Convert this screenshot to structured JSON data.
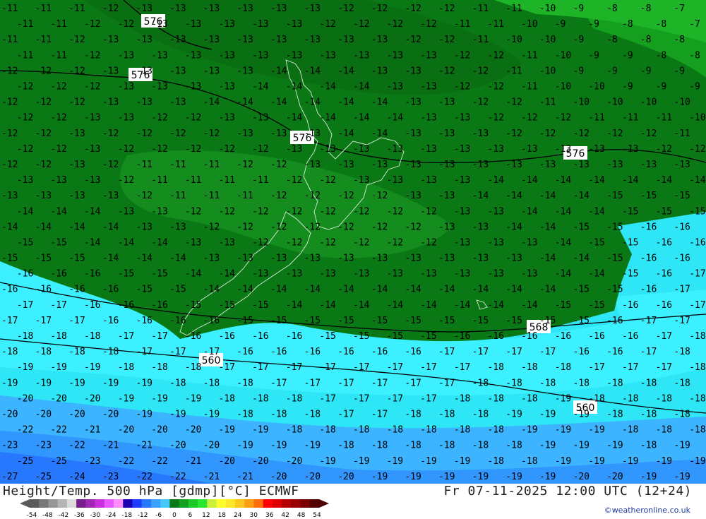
{
  "footer": {
    "title": "Height/Temp. 500 hPa [gdmp][°C] ECMWF",
    "datetime": "Fr 07-11-2025 12:00 UTC (12+24)",
    "credit": "©weatheronline.co.uk"
  },
  "legend": {
    "colors": [
      "#5a5a5a",
      "#787878",
      "#969696",
      "#b4b4b4",
      "#dcdcdc",
      "#781e8c",
      "#a028b4",
      "#c832dc",
      "#e65aff",
      "#ff8cff",
      "#1e00b4",
      "#1e3cff",
      "#2878ff",
      "#3ca0ff",
      "#46c8ff",
      "#0a7814",
      "#14a01e",
      "#1ec828",
      "#28e632",
      "#c8f03c",
      "#ffff28",
      "#ffe628",
      "#ffc81e",
      "#ffa014",
      "#ff6e0a",
      "#ff0000",
      "#dc0000",
      "#b40000",
      "#960000",
      "#780000",
      "#500000"
    ],
    "tick_labels": [
      "-54",
      "-48",
      "-42",
      "-36",
      "-30",
      "-24",
      "-18",
      "-12",
      "-6",
      "0",
      "6",
      "12",
      "18",
      "24",
      "30",
      "36",
      "42",
      "48",
      "54"
    ]
  },
  "height_labels": [
    "576",
    "576",
    "576",
    "576",
    "568",
    "560",
    "560"
  ],
  "temp_rows": [
    {
      "values": [
        "-11",
        "-11",
        "-11",
        "-12",
        "-13",
        "-13",
        "-13",
        "-13",
        "-13",
        "-13",
        "-12",
        "-12",
        "-12",
        "-12",
        "-11",
        "-11",
        "-10",
        "-9",
        "-8",
        "-8",
        "-7"
      ]
    },
    {
      "values": [
        "-11",
        "-11",
        "-12",
        "-12",
        "-13",
        "-13",
        "-13",
        "-13",
        "-13",
        "-12",
        "-12",
        "-12",
        "-12",
        "-11",
        "-11",
        "-10",
        "-9",
        "-9",
        "-8",
        "-8",
        "-7"
      ]
    },
    {
      "values": [
        "-11",
        "-11",
        "-12",
        "-13",
        "-13",
        "-13",
        "-13",
        "-13",
        "-13",
        "-13",
        "-13",
        "-13",
        "-12",
        "-12",
        "-11",
        "-10",
        "-10",
        "-9",
        "-8",
        "-8",
        "-8"
      ]
    },
    {
      "values": [
        "-11",
        "-11",
        "-12",
        "-13",
        "-13",
        "-13",
        "-13",
        "-13",
        "-13",
        "-13",
        "-13",
        "-13",
        "-13",
        "-12",
        "-12",
        "-11",
        "-10",
        "-9",
        "-9",
        "-8",
        "-8"
      ]
    },
    {
      "values": [
        "-12",
        "-12",
        "-12",
        "-13",
        "-13",
        "-13",
        "-13",
        "-13",
        "-14",
        "-14",
        "-14",
        "-13",
        "-13",
        "-12",
        "-12",
        "-11",
        "-10",
        "-9",
        "-9",
        "-9",
        "-9"
      ]
    },
    {
      "values": [
        "-12",
        "-12",
        "-12",
        "-13",
        "-13",
        "-13",
        "-13",
        "-14",
        "-14",
        "-14",
        "-14",
        "-13",
        "-13",
        "-12",
        "-12",
        "-11",
        "-10",
        "-10",
        "-9",
        "-9",
        "-9"
      ]
    },
    {
      "values": [
        "-12",
        "-12",
        "-12",
        "-13",
        "-13",
        "-13",
        "-14",
        "-14",
        "-14",
        "-14",
        "-14",
        "-14",
        "-13",
        "-13",
        "-12",
        "-12",
        "-11",
        "-10",
        "-10",
        "-10",
        "-10"
      ]
    },
    {
      "values": [
        "-12",
        "-12",
        "-13",
        "-13",
        "-12",
        "-12",
        "-13",
        "-13",
        "-14",
        "-14",
        "-14",
        "-14",
        "-13",
        "-13",
        "-12",
        "-12",
        "-12",
        "-11",
        "-11",
        "-11",
        "-10"
      ]
    },
    {
      "values": [
        "-12",
        "-12",
        "-13",
        "-12",
        "-12",
        "-12",
        "-12",
        "-13",
        "-13",
        "-13",
        "-14",
        "-14",
        "-13",
        "-13",
        "-13",
        "-12",
        "-12",
        "-12",
        "-12",
        "-12",
        "-11"
      ]
    },
    {
      "values": [
        "-12",
        "-12",
        "-13",
        "-12",
        "-12",
        "-12",
        "-12",
        "-12",
        "-13",
        "-13",
        "-13",
        "-13",
        "-13",
        "-13",
        "-13",
        "-13",
        "-13",
        "-13",
        "-13",
        "-12",
        "-12"
      ]
    },
    {
      "values": [
        "-12",
        "-12",
        "-13",
        "-12",
        "-11",
        "-11",
        "-11",
        "-12",
        "-12",
        "-13",
        "-13",
        "-13",
        "-13",
        "-13",
        "-13",
        "-13",
        "-13",
        "-13",
        "-13",
        "-13",
        "-13"
      ]
    },
    {
      "values": [
        "-13",
        "-13",
        "-13",
        "-12",
        "-11",
        "-11",
        "-11",
        "-11",
        "-12",
        "-12",
        "-13",
        "-13",
        "-13",
        "-13",
        "-14",
        "-14",
        "-14",
        "-14",
        "-14",
        "-14",
        "-14"
      ]
    },
    {
      "values": [
        "-13",
        "-13",
        "-13",
        "-13",
        "-12",
        "-11",
        "-11",
        "-11",
        "-12",
        "-12",
        "-12",
        "-12",
        "-13",
        "-13",
        "-14",
        "-14",
        "-14",
        "-14",
        "-15",
        "-15",
        "-15"
      ]
    },
    {
      "values": [
        "-14",
        "-14",
        "-14",
        "-13",
        "-13",
        "-12",
        "-12",
        "-12",
        "-12",
        "-12",
        "-12",
        "-12",
        "-12",
        "-13",
        "-13",
        "-14",
        "-14",
        "-14",
        "-15",
        "-15",
        "-15"
      ]
    },
    {
      "values": [
        "-14",
        "-14",
        "-14",
        "-14",
        "-13",
        "-13",
        "-12",
        "-12",
        "-12",
        "-12",
        "-12",
        "-12",
        "-12",
        "-13",
        "-13",
        "-14",
        "-14",
        "-15",
        "-15",
        "-16",
        "-16"
      ]
    },
    {
      "values": [
        "-15",
        "-15",
        "-14",
        "-14",
        "-14",
        "-13",
        "-13",
        "-12",
        "-12",
        "-12",
        "-12",
        "-12",
        "-12",
        "-13",
        "-13",
        "-13",
        "-14",
        "-15",
        "-15",
        "-16",
        "-16"
      ]
    },
    {
      "values": [
        "-15",
        "-15",
        "-15",
        "-14",
        "-14",
        "-14",
        "-13",
        "-13",
        "-13",
        "-13",
        "-13",
        "-13",
        "-13",
        "-13",
        "-13",
        "-13",
        "-14",
        "-14",
        "-15",
        "-16",
        "-16"
      ]
    },
    {
      "values": [
        "-16",
        "-16",
        "-16",
        "-15",
        "-15",
        "-14",
        "-14",
        "-13",
        "-13",
        "-13",
        "-13",
        "-13",
        "-13",
        "-13",
        "-13",
        "-13",
        "-14",
        "-14",
        "-15",
        "-16",
        "-17"
      ]
    },
    {
      "values": [
        "-16",
        "-16",
        "-16",
        "-16",
        "-15",
        "-15",
        "-14",
        "-14",
        "-14",
        "-14",
        "-14",
        "-14",
        "-14",
        "-14",
        "-14",
        "-14",
        "-14",
        "-15",
        "-15",
        "-16",
        "-17"
      ]
    },
    {
      "values": [
        "-17",
        "-17",
        "-16",
        "-16",
        "-16",
        "-15",
        "-15",
        "-15",
        "-14",
        "-14",
        "-14",
        "-14",
        "-14",
        "-14",
        "-14",
        "-14",
        "-15",
        "-15",
        "-16",
        "-16",
        "-17"
      ]
    },
    {
      "values": [
        "-17",
        "-17",
        "-17",
        "-16",
        "-16",
        "-16",
        "-16",
        "-15",
        "-15",
        "-15",
        "-15",
        "-15",
        "-15",
        "-15",
        "-15",
        "-15",
        "-15",
        "-15",
        "-16",
        "-17",
        "-17"
      ]
    },
    {
      "values": [
        "-18",
        "-18",
        "-18",
        "-17",
        "-17",
        "-16",
        "-16",
        "-16",
        "-16",
        "-15",
        "-15",
        "-15",
        "-15",
        "-16",
        "-16",
        "-16",
        "-16",
        "-16",
        "-16",
        "-17",
        "-18"
      ]
    },
    {
      "values": [
        "-18",
        "-18",
        "-18",
        "-18",
        "-17",
        "-17",
        "-17",
        "-16",
        "-16",
        "-16",
        "-16",
        "-16",
        "-16",
        "-17",
        "-17",
        "-17",
        "-17",
        "-16",
        "-16",
        "-17",
        "-18"
      ]
    },
    {
      "values": [
        "-19",
        "-19",
        "-19",
        "-18",
        "-18",
        "-18",
        "-17",
        "-17",
        "-17",
        "-17",
        "-17",
        "-17",
        "-17",
        "-17",
        "-18",
        "-18",
        "-18",
        "-17",
        "-17",
        "-17",
        "-18"
      ]
    },
    {
      "values": [
        "-19",
        "-19",
        "-19",
        "-19",
        "-19",
        "-18",
        "-18",
        "-18",
        "-17",
        "-17",
        "-17",
        "-17",
        "-17",
        "-17",
        "-18",
        "-18",
        "-18",
        "-18",
        "-18",
        "-18",
        "-18"
      ]
    },
    {
      "values": [
        "-20",
        "-20",
        "-20",
        "-19",
        "-19",
        "-19",
        "-18",
        "-18",
        "-18",
        "-17",
        "-17",
        "-17",
        "-17",
        "-18",
        "-18",
        "-18",
        "-19",
        "-18",
        "-18",
        "-18",
        "-18"
      ]
    },
    {
      "values": [
        "-20",
        "-20",
        "-20",
        "-20",
        "-19",
        "-19",
        "-19",
        "-18",
        "-18",
        "-18",
        "-17",
        "-17",
        "-18",
        "-18",
        "-18",
        "-19",
        "-19",
        "-19",
        "-18",
        "-18",
        "-18"
      ]
    },
    {
      "values": [
        "-22",
        "-22",
        "-21",
        "-20",
        "-20",
        "-20",
        "-19",
        "-19",
        "-18",
        "-18",
        "-18",
        "-18",
        "-18",
        "-18",
        "-18",
        "-19",
        "-19",
        "-19",
        "-18",
        "-18",
        "-18"
      ]
    },
    {
      "values": [
        "-23",
        "-23",
        "-22",
        "-21",
        "-21",
        "-20",
        "-20",
        "-19",
        "-19",
        "-19",
        "-18",
        "-18",
        "-18",
        "-18",
        "-18",
        "-18",
        "-19",
        "-19",
        "-19",
        "-18",
        "-19"
      ]
    },
    {
      "values": [
        "-25",
        "-25",
        "-23",
        "-22",
        "-22",
        "-21",
        "-20",
        "-20",
        "-20",
        "-19",
        "-19",
        "-19",
        "-19",
        "-19",
        "-18",
        "-18",
        "-19",
        "-19",
        "-19",
        "-19",
        "-19"
      ]
    },
    {
      "values": [
        "-27",
        "-25",
        "-24",
        "-23",
        "-22",
        "-22",
        "-21",
        "-21",
        "-20",
        "-20",
        "-20",
        "-19",
        "-19",
        "-19",
        "-19",
        "-19",
        "-19",
        "-20",
        "-20",
        "-19",
        "-19"
      ]
    }
  ]
}
